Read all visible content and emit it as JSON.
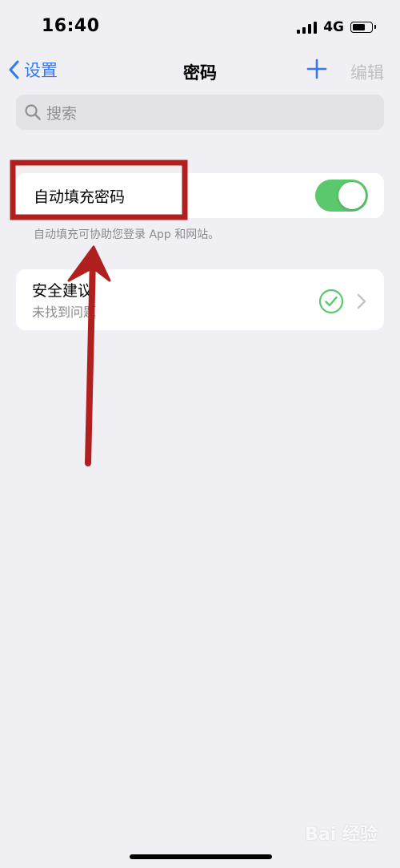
{
  "status_bar": {
    "time": "16:40",
    "network": "4G"
  },
  "nav": {
    "back_label": "设置",
    "title": "密码",
    "edit_label": "编辑"
  },
  "search": {
    "placeholder": "搜索"
  },
  "autofill": {
    "label": "自动填充密码",
    "enabled": true,
    "footer": "自动填充可协助您登录 App 和网站。"
  },
  "security": {
    "title": "安全建议",
    "subtitle": "未找到问题",
    "status_icon": "check-circle-icon"
  },
  "watermark": {
    "text": "Bai 经验"
  },
  "colors": {
    "accent": "#3478f6",
    "toggle_on": "#5bc86d",
    "check": "#5bc86d",
    "annotation": "#b0201e",
    "background": "#efeff4"
  }
}
